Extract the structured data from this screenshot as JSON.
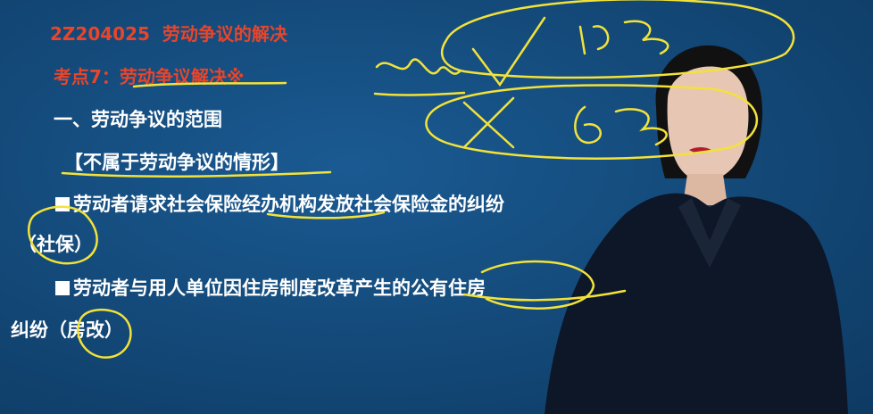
{
  "slide": {
    "title_code": "2Z204025",
    "title_text": "劳动争议的解决",
    "point_label": "考点7：劳动争议解决※",
    "section_heading": "一、劳动争议的范围",
    "box_heading": "【不属于劳动争议的情形】",
    "item1": "劳动者请求社会保险经办机构发放社会保险金的纠纷",
    "item1_note": "（社保）",
    "item2": "劳动者与用人单位因住房制度改革产生的公有住房",
    "item2_cont": "纠纷",
    "item2_note": "（房改）"
  },
  "colors": {
    "board": "#134877",
    "title_red": "#e8452b",
    "ink_yellow": "#f2e23a"
  }
}
